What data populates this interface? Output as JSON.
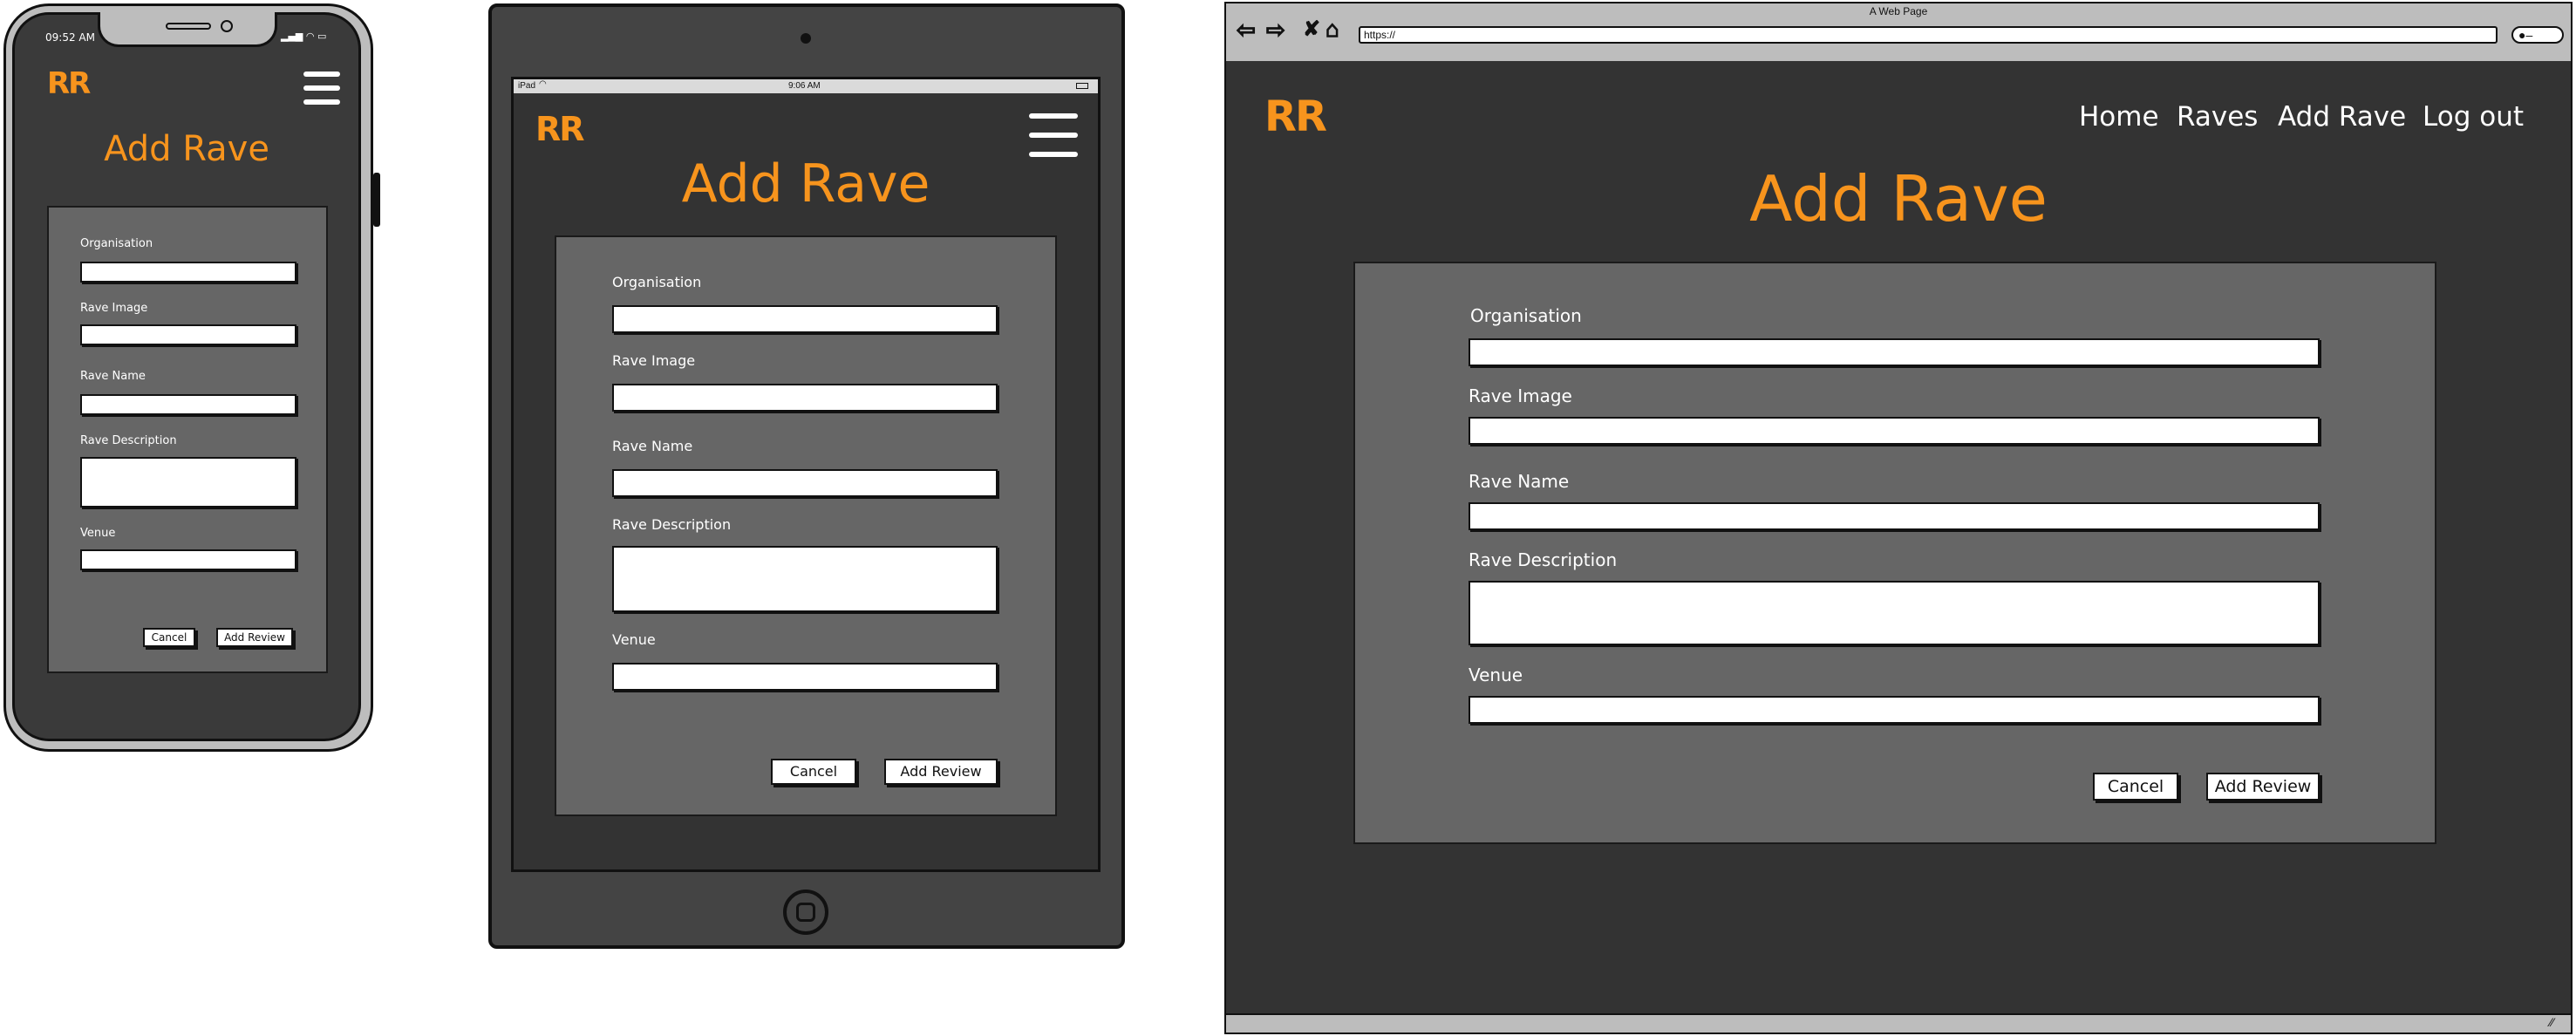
{
  "colors": {
    "accent": "#f7941d",
    "screen": "#333333",
    "panel": "#666666"
  },
  "phone": {
    "status_time": "09:52 AM",
    "logo": "RR",
    "title": "Add Rave",
    "menu_icon": "hamburger-icon"
  },
  "tablet": {
    "status_left": "iPad",
    "status_time": "9:06 AM",
    "logo": "RR",
    "title": "Add Rave",
    "menu_icon": "hamburger-icon"
  },
  "browser": {
    "window_title": "A Web Page",
    "url": "https://",
    "logo": "RR",
    "title": "Add Rave",
    "nav": [
      "Home",
      "Raves",
      "Add Rave",
      "Log out"
    ]
  },
  "form": {
    "organisation_label": "Organisation",
    "image_label": "Rave Image",
    "name_label": "Rave Name",
    "description_label": "Rave Description",
    "venue_label": "Venue",
    "cancel_label": "Cancel",
    "submit_label": "Add Review"
  }
}
